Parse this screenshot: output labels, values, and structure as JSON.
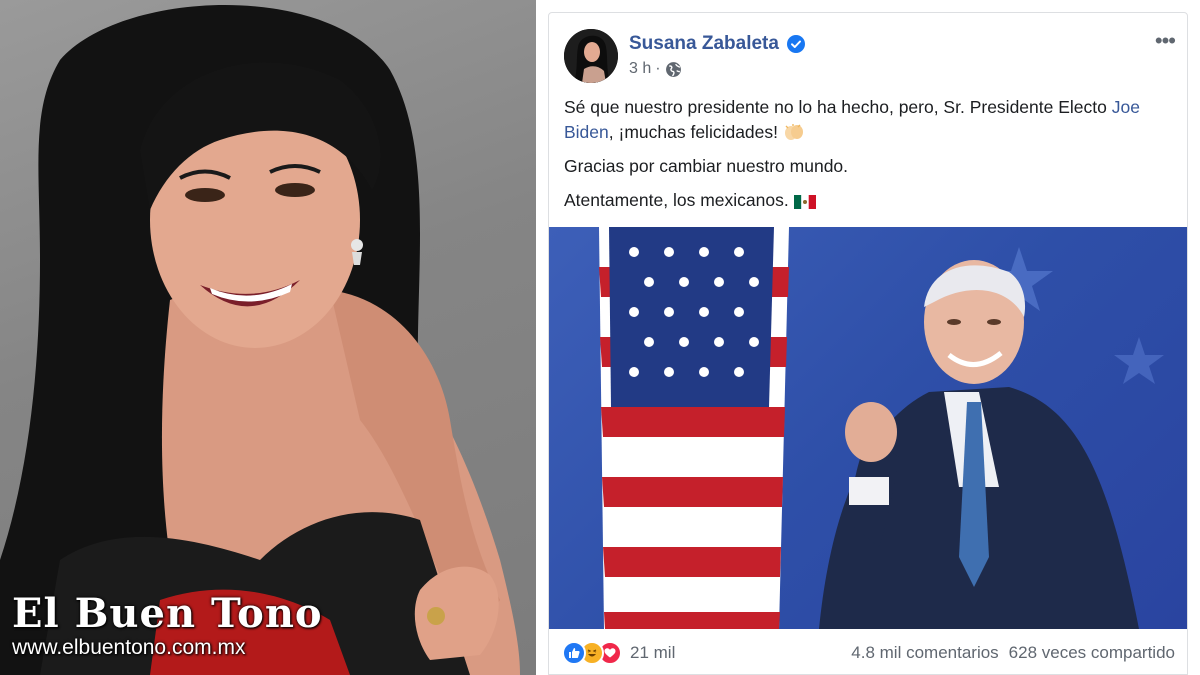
{
  "watermark": {
    "title": "El Buen Tono",
    "url": "www.elbuentono.com.mx"
  },
  "post": {
    "author": "Susana Zabaleta",
    "verified_icon": "verified-badge-icon",
    "time": "3 h",
    "audience_icon": "globe-icon",
    "more_icon": "more-options-icon",
    "text": {
      "line1_before": "Sé que nuestro presidente no lo ha hecho, pero, Sr. Presidente Electo ",
      "mention": "Joe Biden",
      "line1_after": ", ¡muchas felicidades! ",
      "line2": "Gracias por cambiar nuestro mundo.",
      "line3": "Atentamente, los mexicanos. "
    },
    "emojis": [
      "clapping-hands-emoji",
      "mexico-flag-emoji"
    ]
  },
  "reactions": {
    "icons": [
      "like-icon",
      "haha-icon",
      "love-icon"
    ],
    "count": "21 mil",
    "comments": "4.8 mil comentarios",
    "shares": "628 veces compartido"
  },
  "colors": {
    "fb_link": "#385898",
    "meta_gray": "#606770",
    "text_dark": "#1c1e21",
    "image_blue": "#2e4fa8"
  }
}
